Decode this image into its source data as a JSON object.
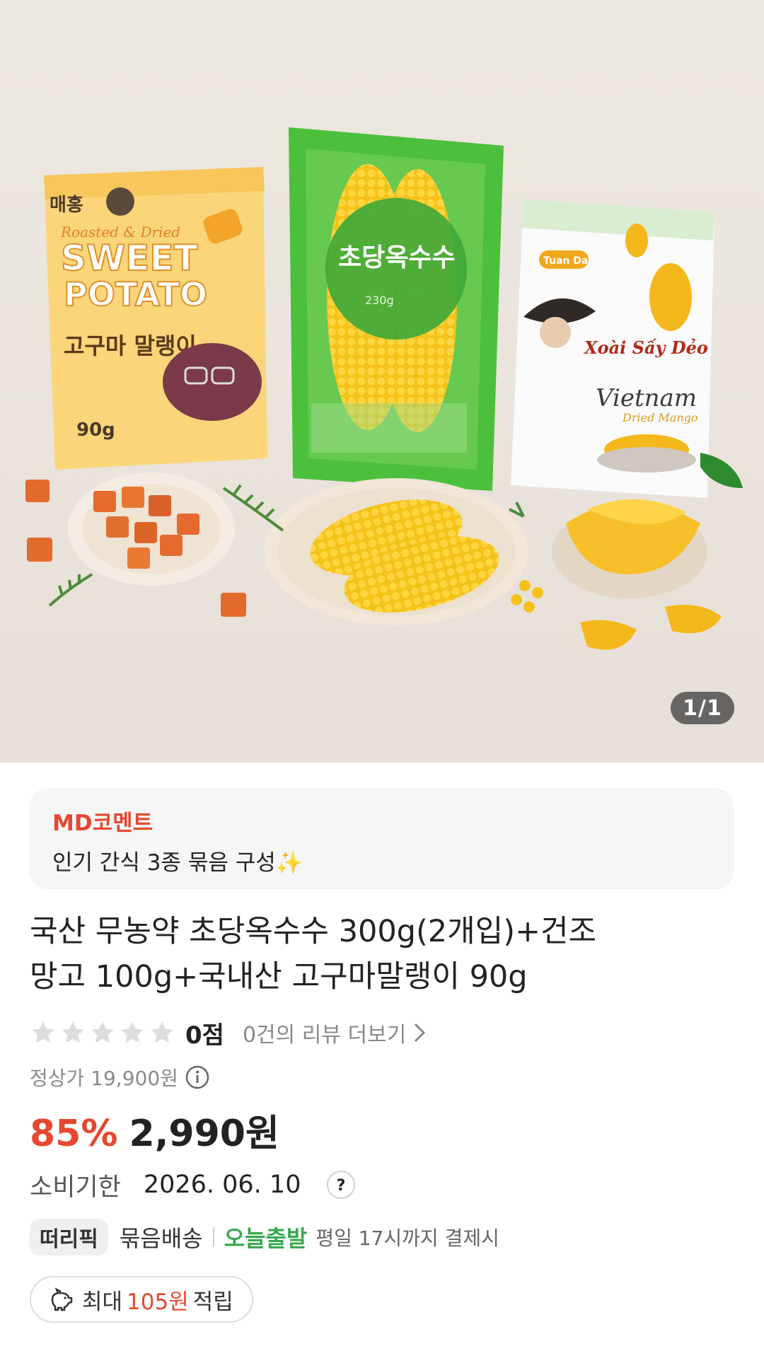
{
  "gallery": {
    "counter": "1/1",
    "image_labels": {
      "potato_brand": "매홍",
      "potato_sub": "Roasted & Dried",
      "potato_line1": "SWEET",
      "potato_line2": "POTATO",
      "potato_korean": "고구마 말랭이",
      "potato_weight": "90g",
      "corn_label": "초당옥수수",
      "corn_weight": "230g",
      "mango_brand": "Tuan Dat",
      "mango_name": "Xoài Sấy Dẻo",
      "mango_country": "Vietnam",
      "mango_sub": "Dried Mango"
    }
  },
  "md_comment": {
    "title": "MD코멘트",
    "text": "인기 간식 3종 묶음 구성✨"
  },
  "product": {
    "title_line1": "국산 무농약 초당옥수수 300g(2개입)+건조",
    "title_line2": "망고 100g+국내산 고구마말랭이 90g"
  },
  "rating": {
    "stars_filled": 0,
    "stars_total": 5,
    "score": "0점",
    "review_link": "0건의 리뷰 더보기"
  },
  "price": {
    "regular": "정상가 19,900원",
    "discount": "85%",
    "sale": "2,990원"
  },
  "expiry": {
    "label": "소비기한",
    "value": "2026. 06. 10",
    "help": "?"
  },
  "delivery": {
    "badge": "떠리픽",
    "bundle": "묶음배송",
    "today": "오늘출발",
    "condition": "평일 17시까지 결제시"
  },
  "points": {
    "prefix": "최대",
    "amount": "105원",
    "suffix": "적립"
  },
  "colors": {
    "accent": "#e5482f",
    "green": "#3aa84f",
    "star_empty": "#dddddd"
  }
}
